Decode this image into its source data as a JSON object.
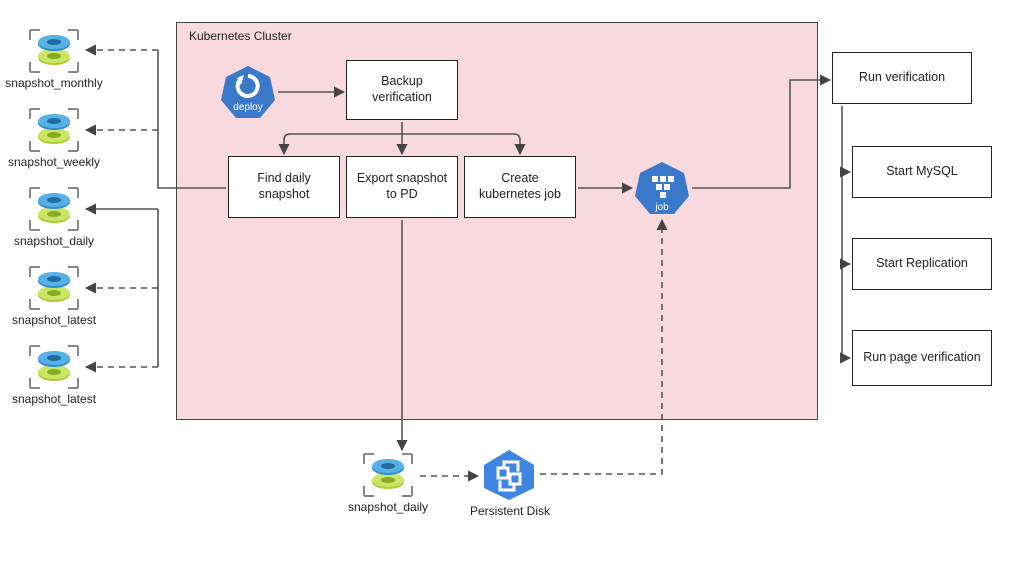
{
  "cluster": {
    "title": "Kubernetes Cluster"
  },
  "snapshots": {
    "s0": "snapshot_monthly",
    "s1": "snapshot_weekly",
    "s2": "snapshot_daily",
    "s3": "snapshot_latest",
    "s4": "snapshot_latest"
  },
  "nodes": {
    "deploy": "deploy",
    "backup_verification": "Backup verification",
    "find_daily": "Find daily snapshot",
    "export_pd": "Export snapshot to PD",
    "create_job": "Create kubernetes job",
    "job": "job",
    "run_verification": "Run verification",
    "start_mysql": "Start MySQL",
    "start_replication": "Start Replication",
    "run_page_verification": "Run page verification",
    "snapshot_daily_bottom": "snapshot_daily",
    "persistent_disk": "Persistent Disk"
  },
  "chart_data": {
    "type": "diagram",
    "title": "Kubernetes Cluster",
    "nodes": [
      {
        "id": "snapshot_monthly",
        "label": "snapshot_monthly",
        "kind": "snapshot-icon"
      },
      {
        "id": "snapshot_weekly",
        "label": "snapshot_weekly",
        "kind": "snapshot-icon"
      },
      {
        "id": "snapshot_daily",
        "label": "snapshot_daily",
        "kind": "snapshot-icon"
      },
      {
        "id": "snapshot_latest_1",
        "label": "snapshot_latest",
        "kind": "snapshot-icon"
      },
      {
        "id": "snapshot_latest_2",
        "label": "snapshot_latest",
        "kind": "snapshot-icon"
      },
      {
        "id": "deploy",
        "label": "deploy",
        "kind": "k8s-deploy-badge"
      },
      {
        "id": "backup_verification",
        "label": "Backup verification",
        "kind": "process-box"
      },
      {
        "id": "find_daily",
        "label": "Find daily snapshot",
        "kind": "process-box"
      },
      {
        "id": "export_pd",
        "label": "Export snapshot to PD",
        "kind": "process-box"
      },
      {
        "id": "create_job",
        "label": "Create kubernetes job",
        "kind": "process-box"
      },
      {
        "id": "job",
        "label": "job",
        "kind": "k8s-job-badge"
      },
      {
        "id": "run_verification",
        "label": "Run verification",
        "kind": "process-box"
      },
      {
        "id": "start_mysql",
        "label": "Start MySQL",
        "kind": "process-box"
      },
      {
        "id": "start_replication",
        "label": "Start Replication",
        "kind": "process-box"
      },
      {
        "id": "run_page_verification",
        "label": "Run page verification",
        "kind": "process-box"
      },
      {
        "id": "snapshot_daily_bottom",
        "label": "snapshot_daily",
        "kind": "snapshot-icon"
      },
      {
        "id": "persistent_disk",
        "label": "Persistent Disk",
        "kind": "gcp-pd-badge"
      }
    ],
    "edges": [
      {
        "from": "deploy",
        "to": "backup_verification",
        "style": "solid"
      },
      {
        "from": "backup_verification",
        "to": "find_daily",
        "style": "solid"
      },
      {
        "from": "backup_verification",
        "to": "export_pd",
        "style": "solid"
      },
      {
        "from": "backup_verification",
        "to": "create_job",
        "style": "solid"
      },
      {
        "from": "create_job",
        "to": "job",
        "style": "solid"
      },
      {
        "from": "job",
        "to": "run_verification",
        "style": "solid"
      },
      {
        "from": "run_verification",
        "to": "start_mysql",
        "style": "solid"
      },
      {
        "from": "run_verification",
        "to": "start_replication",
        "style": "solid"
      },
      {
        "from": "run_verification",
        "to": "run_page_verification",
        "style": "solid"
      },
      {
        "from": "find_daily",
        "to": "snapshot_monthly",
        "style": "dashed"
      },
      {
        "from": "find_daily",
        "to": "snapshot_weekly",
        "style": "dashed"
      },
      {
        "from": "find_daily",
        "to": "snapshot_daily",
        "style": "solid"
      },
      {
        "from": "find_daily",
        "to": "snapshot_latest_1",
        "style": "dashed"
      },
      {
        "from": "find_daily",
        "to": "snapshot_latest_2",
        "style": "dashed"
      },
      {
        "from": "export_pd",
        "to": "snapshot_daily_bottom",
        "style": "solid"
      },
      {
        "from": "snapshot_daily_bottom",
        "to": "persistent_disk",
        "style": "dashed"
      },
      {
        "from": "persistent_disk",
        "to": "job",
        "style": "dashed"
      }
    ],
    "groups": [
      {
        "id": "kubernetes_cluster",
        "label": "Kubernetes Cluster",
        "members": [
          "deploy",
          "backup_verification",
          "find_daily",
          "export_pd",
          "create_job",
          "job"
        ]
      }
    ]
  }
}
